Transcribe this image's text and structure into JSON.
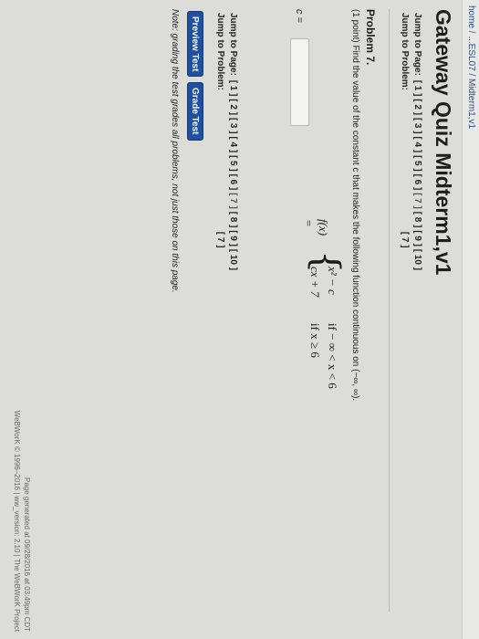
{
  "breadcrumb": "home / ...ESL07 / Midterm1,v1",
  "title": "Gateway Quiz Midterm1,v1",
  "top_nav": {
    "jump_page_label": "Jump to Page:",
    "pages": [
      "[ 1 ]",
      "[ 2 ]",
      "[ 3 ]",
      "[ 4 ]",
      "[ 5 ]",
      "[ 6 ]",
      "[ 7 ]",
      "[ 8 ]",
      "[ 9 ]",
      "[ 10 ]"
    ],
    "current_page": "[ 7 ]",
    "jump_problem_label": "Jump to Problem:",
    "problem": "[ 7 ]"
  },
  "problem": {
    "title": "Problem 7.",
    "points": "(1 point)",
    "statement": "Find the value of the constant c that makes the following function continuous on (−∞, ∞).",
    "function_lhs": "f(x) =",
    "case1_expr": "x² − c",
    "case1_cond": "if  − ∞ < x < 6",
    "case2_expr": "cx + 7",
    "case2_cond": "if x ≥ 6",
    "answer_label": "c =",
    "answer_value": ""
  },
  "bottom_nav": {
    "jump_page_label": "Jump to Page:",
    "pages": [
      "[ 1 ]",
      "[ 2 ]",
      "[ 3 ]",
      "[ 4 ]",
      "[ 5 ]",
      "[ 6 ]",
      "[ 7 ]",
      "[ 8 ]",
      "[ 9 ]",
      "[ 10 ]"
    ],
    "current_page": "[ 7 ]",
    "jump_problem_label": "Jump to Problem:",
    "problem": "[ 7 ]"
  },
  "buttons": {
    "preview": "Preview Test",
    "grade": "Grade Test"
  },
  "note": "Note: grading the test grades all problems, not just those on this page.",
  "footer": {
    "generated": "Page generated at 09/28/2016 at 03:49pm CDT",
    "version": "WeBWorK © 1996–2016 | ww_version: 2.10 | The WeBWorK Project"
  }
}
